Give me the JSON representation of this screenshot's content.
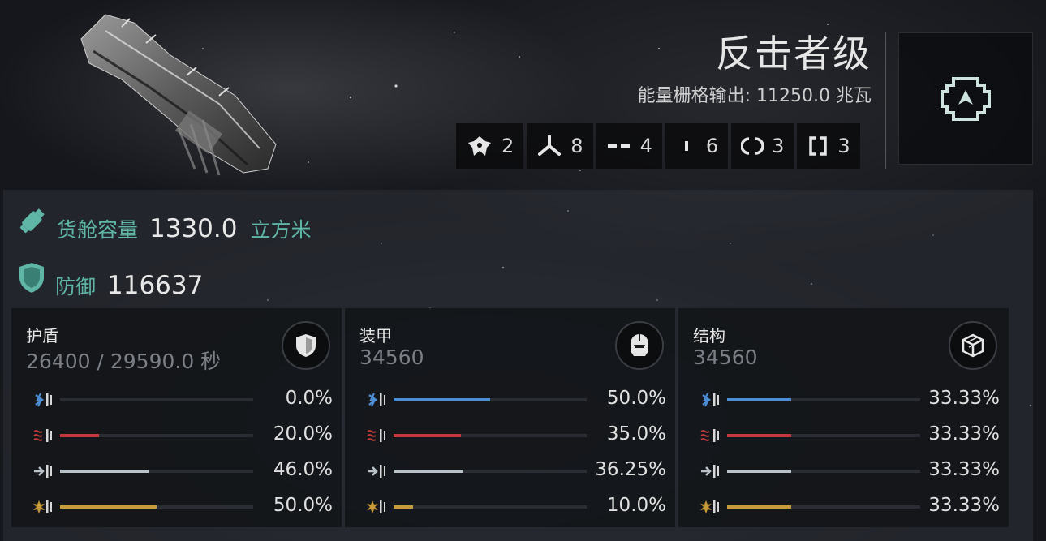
{
  "ship": {
    "name": "反击者级",
    "power_label": "能量栅格输出:",
    "power_value": "11250.0 兆瓦"
  },
  "slots": [
    {
      "icon": "high-slot-icon",
      "count": "2"
    },
    {
      "icon": "mid-slot-icon",
      "count": "8"
    },
    {
      "icon": "low-slot-icon",
      "count": "4"
    },
    {
      "icon": "rig-slot-icon",
      "count": "6"
    },
    {
      "icon": "launcher-icon",
      "count": "3"
    },
    {
      "icon": "turret-icon",
      "count": "3"
    }
  ],
  "cargo": {
    "label": "货舱容量",
    "value": "1330.0",
    "unit": "立方米"
  },
  "defense": {
    "label": "防御",
    "value": "116637"
  },
  "layers": [
    {
      "name": "护盾",
      "value": "26400 / 29590.0 秒",
      "icon": "shield-icon",
      "resists": [
        {
          "type": "em",
          "percent": "0.0%",
          "fraction": 0.0
        },
        {
          "type": "thermal",
          "percent": "20.0%",
          "fraction": 0.2
        },
        {
          "type": "kinetic",
          "percent": "46.0%",
          "fraction": 0.46
        },
        {
          "type": "explosive",
          "percent": "50.0%",
          "fraction": 0.5
        }
      ]
    },
    {
      "name": "装甲",
      "value": "34560",
      "icon": "armor-helmet-icon",
      "resists": [
        {
          "type": "em",
          "percent": "50.0%",
          "fraction": 0.5
        },
        {
          "type": "thermal",
          "percent": "35.0%",
          "fraction": 0.35
        },
        {
          "type": "kinetic",
          "percent": "36.25%",
          "fraction": 0.3625
        },
        {
          "type": "explosive",
          "percent": "10.0%",
          "fraction": 0.1
        }
      ]
    },
    {
      "name": "结构",
      "value": "34560",
      "icon": "structure-cube-icon",
      "resists": [
        {
          "type": "em",
          "percent": "33.33%",
          "fraction": 0.3333
        },
        {
          "type": "thermal",
          "percent": "33.33%",
          "fraction": 0.3333
        },
        {
          "type": "kinetic",
          "percent": "33.33%",
          "fraction": 0.3333
        },
        {
          "type": "explosive",
          "percent": "33.33%",
          "fraction": 0.3333
        }
      ]
    }
  ],
  "colors": {
    "em": "#4d8fd6",
    "thermal": "#c23a3a",
    "kinetic": "#b9c1c9",
    "explosive": "#c79a3c",
    "teal": "#5fb5a6"
  }
}
